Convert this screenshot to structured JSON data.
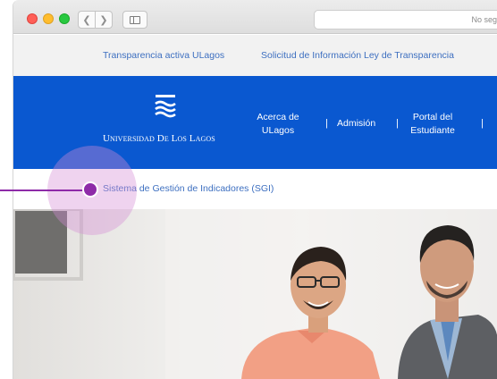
{
  "browser": {
    "url_text": "No seg"
  },
  "topbar": {
    "links": [
      "Transparencia activa ULagos",
      "Solicitud de Información Ley de Transparencia"
    ]
  },
  "header": {
    "logo_text": "Universidad De Los Lagos",
    "menu": [
      {
        "label": "Acerca de\nULagos"
      },
      {
        "label": "Admisión"
      },
      {
        "label": "Portal del\nEstudiante"
      }
    ],
    "separator": "|"
  },
  "breadcrumb": {
    "label": "Sistema de Gestión de Indicadores (SGI)"
  },
  "colors": {
    "brand_blue": "#0a58d0",
    "link_blue": "#3d6fc0",
    "annotation_purple": "#8e2ba8"
  }
}
